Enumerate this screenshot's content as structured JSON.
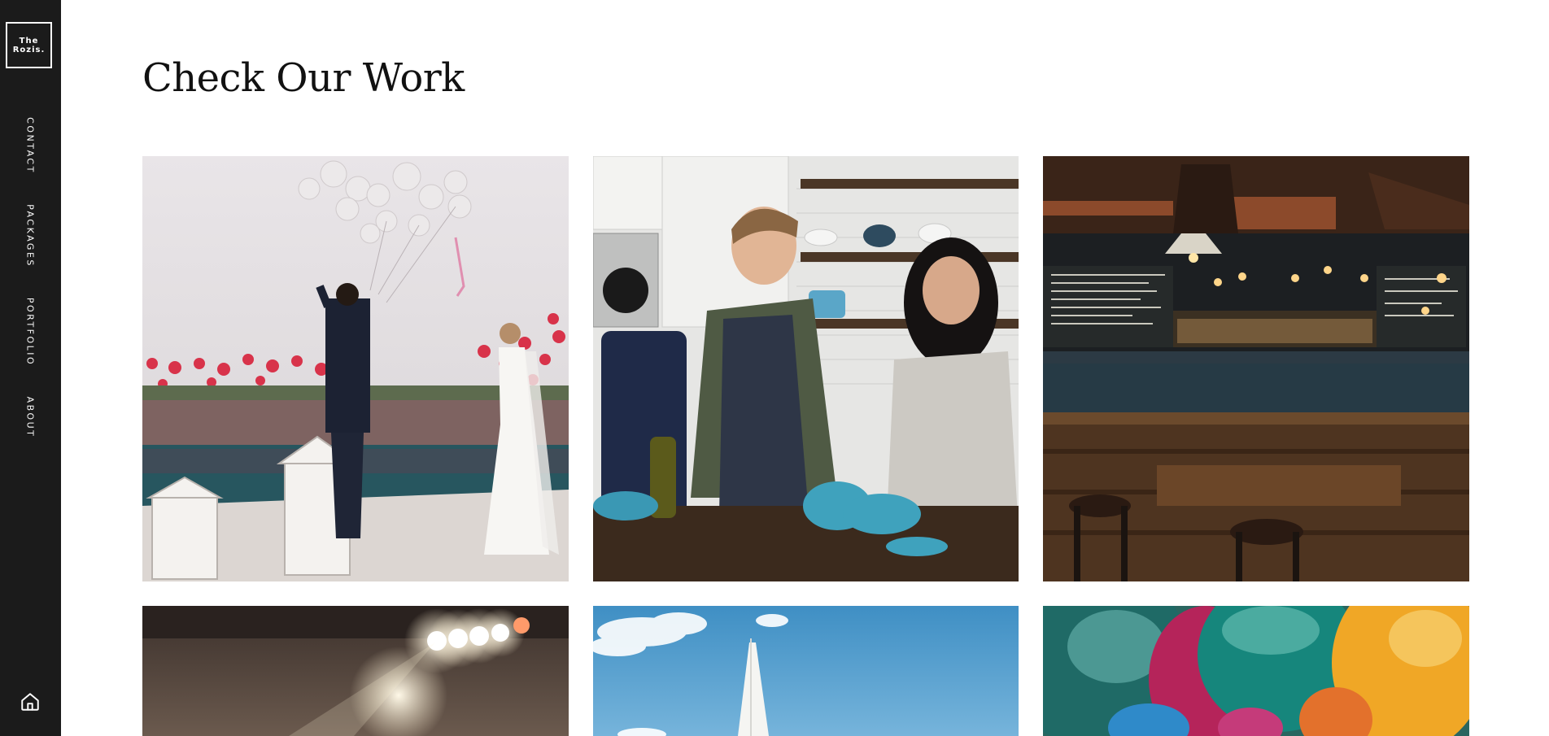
{
  "brand": {
    "line1": "The",
    "line2": "Rozis."
  },
  "nav": [
    {
      "label": "CONTACT"
    },
    {
      "label": "PACKAGES"
    },
    {
      "label": "PORTFOLIO"
    },
    {
      "label": "ABOUT"
    }
  ],
  "home_icon": "home-icon",
  "page": {
    "title": "Check Our Work"
  },
  "gallery": [
    {
      "subject": "wedding couple releasing balloons by pool"
    },
    {
      "subject": "couple cooking in kitchen"
    },
    {
      "subject": "bar with shelves of bottles"
    },
    {
      "subject": "concert stage lights"
    },
    {
      "subject": "sailboat under blue sky"
    },
    {
      "subject": "colorful balloons close-up"
    }
  ],
  "colors": {
    "sidebar": "#1b1b1b",
    "background": "#ffffff",
    "text": "#111111"
  }
}
